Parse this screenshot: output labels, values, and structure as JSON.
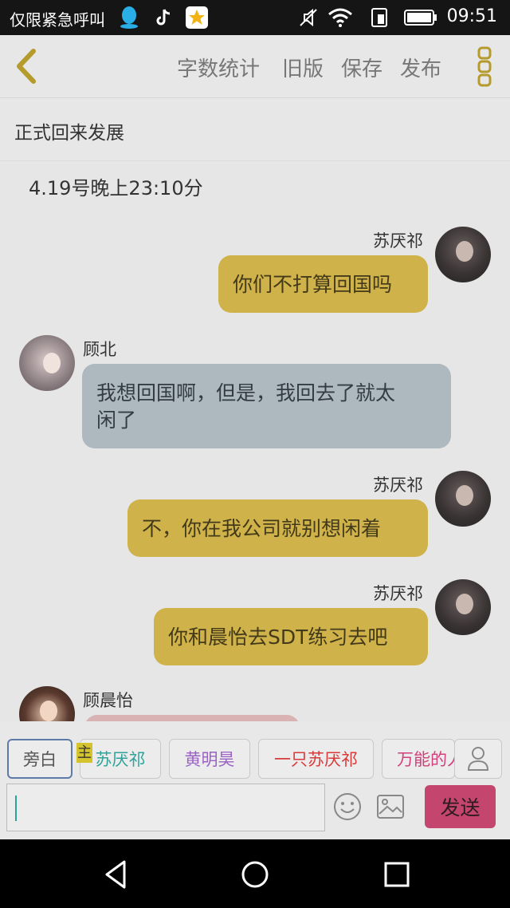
{
  "status_bar": {
    "carrier": "仅限紧急呼叫",
    "time": "09:51",
    "icons": [
      "qq-icon",
      "tiktok-icon",
      "star-app-icon",
      "mute-icon",
      "wifi-icon",
      "sim-icon",
      "battery-icon"
    ]
  },
  "toolbar": {
    "word_count": "字数统计",
    "old_version": "旧版",
    "save": "保存",
    "publish": "发布"
  },
  "title": "正式回来发展",
  "chat": {
    "time_note": "4.19号晚上23:10分",
    "messages": [
      {
        "side": "right",
        "sender": "苏厌祁",
        "text": "你们不打算回国吗"
      },
      {
        "side": "left",
        "sender": "顾北",
        "text_line1": "我想回国啊，但是，我回去了就太",
        "text_line2": "闲了"
      },
      {
        "side": "right",
        "sender": "苏厌祁",
        "text": "不，你在我公司就别想闲着"
      },
      {
        "side": "right",
        "sender": "苏厌祁",
        "text": "你和晨怡去SDT练习去吧"
      },
      {
        "side": "left",
        "sender": "顾晨怡",
        "text": ""
      }
    ]
  },
  "roles": {
    "narration": "旁白",
    "main_badge": "主",
    "items": [
      "苏厌祁",
      "黄明昊",
      "一只苏厌祁",
      "万能的人"
    ],
    "colors": [
      "#2fa39a",
      "#9a62c4",
      "#d83a3a",
      "#d0407a"
    ]
  },
  "input": {
    "value": "",
    "send": "发送"
  },
  "colors": {
    "accent_gold": "#cfb249",
    "bubble_gray": "#aeb8bf",
    "send_pink": "#c4456e"
  }
}
